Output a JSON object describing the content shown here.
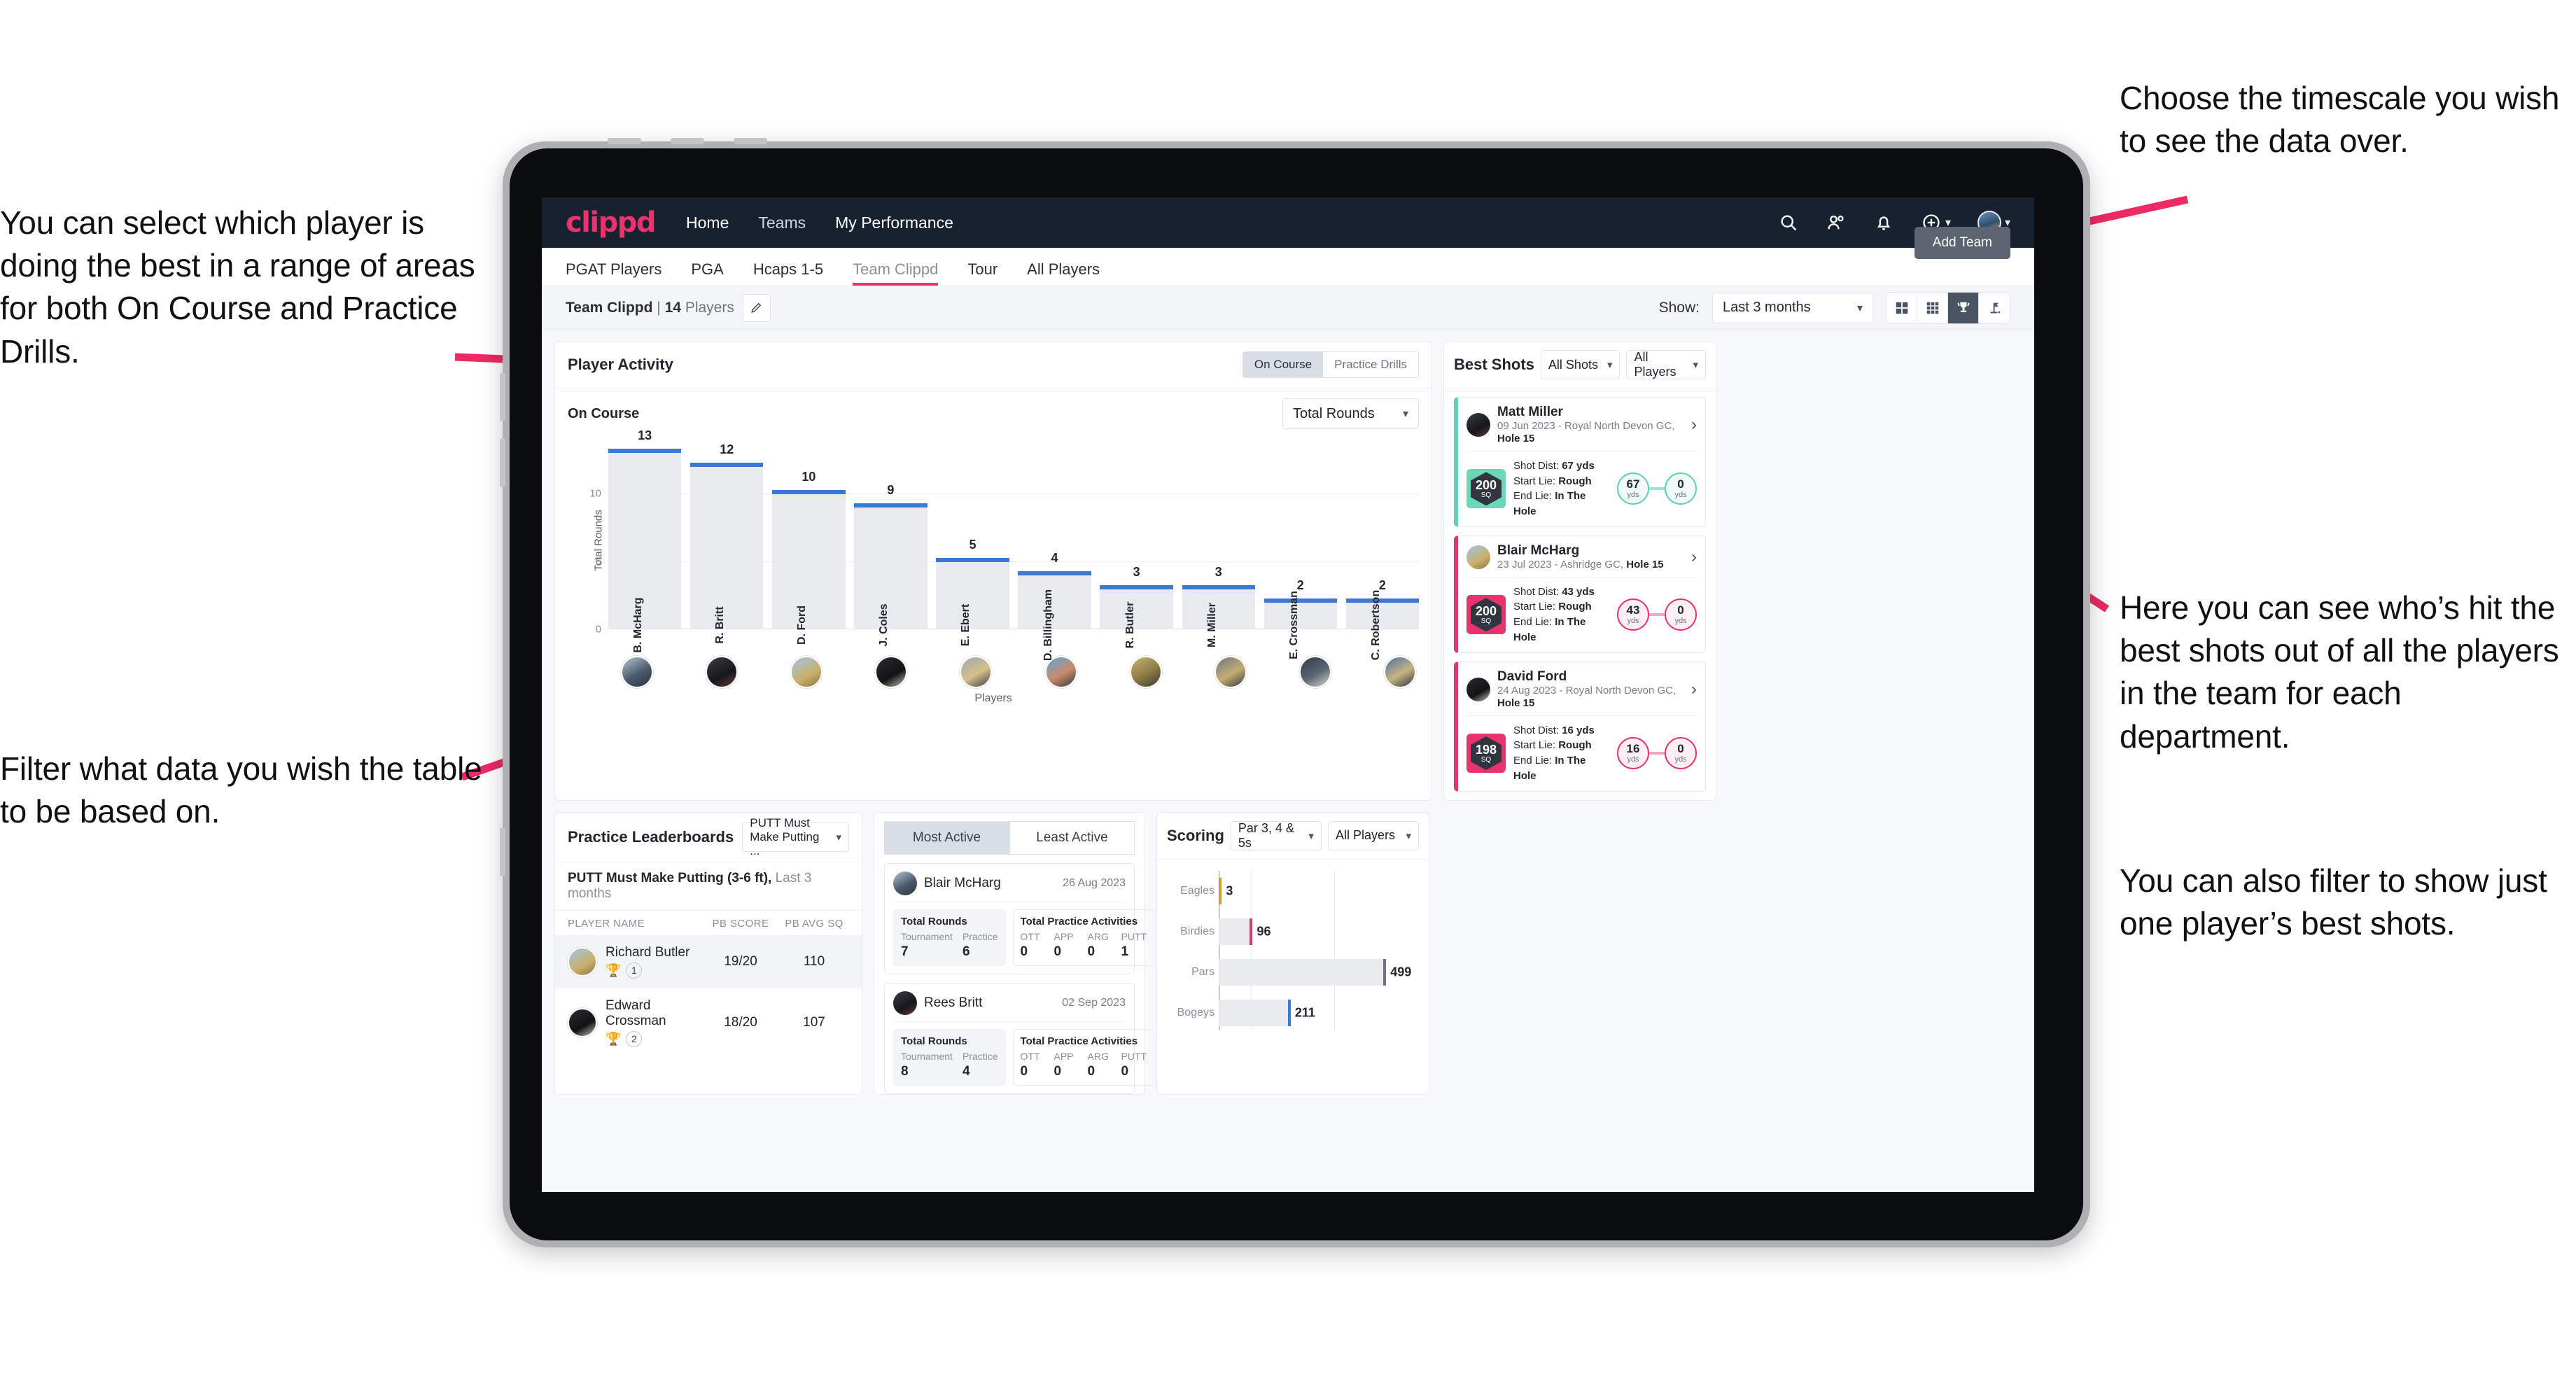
{
  "annotations": {
    "left_top": "You can select which player is doing the best in a range of areas for both On Course and Practice Drills.",
    "left_bottom": "Filter what data you wish the table to be based on.",
    "right_top": "Choose the timescale you wish to see the data over.",
    "right_mid": "Here you can see who’s hit the best shots out of all the players in the team for each department.",
    "right_bottom": "You can also filter to show just one player’s best shots."
  },
  "topnav": {
    "brand": "clippd",
    "links": [
      {
        "label": "Home",
        "active": true
      },
      {
        "label": "Teams",
        "active": false
      },
      {
        "label": "My Performance",
        "active": true
      }
    ],
    "icons": [
      "search-icon",
      "people-icon",
      "bell-icon",
      "plus-circle-icon",
      "avatar"
    ]
  },
  "subtabs": [
    {
      "label": "PGAT Players",
      "active": false
    },
    {
      "label": "PGA",
      "active": false
    },
    {
      "label": "Hcaps 1-5",
      "active": false
    },
    {
      "label": "Team Clippd",
      "active": true
    },
    {
      "label": "Tour",
      "active": false
    },
    {
      "label": "All Players",
      "active": false
    }
  ],
  "add_team_button": "Add Team",
  "toolbar": {
    "team_name": "Team Clippd",
    "separator": "|",
    "player_count": "14",
    "players_word": "Players",
    "show_label": "Show:",
    "timescale_value": "Last 3 months",
    "view_buttons": [
      "grid-2x2-icon",
      "grid-3x3-icon",
      "trophy-icon",
      "flagstick-icon"
    ],
    "active_view": 2
  },
  "player_activity": {
    "title": "Player Activity",
    "segments": [
      {
        "label": "On Course",
        "active": true
      },
      {
        "label": "Practice Drills",
        "active": false
      }
    ],
    "sub_label": "On Course",
    "metric_select": "Total Rounds",
    "x_axis_label": "Players",
    "chart_data": {
      "type": "bar",
      "title": "On Course",
      "xlabel": "Players",
      "ylabel": "Total Rounds",
      "ylim": [
        0,
        14
      ],
      "yticks": [
        0,
        5,
        10
      ],
      "grid": true,
      "categories": [
        "B. McHarg",
        "R. Britt",
        "D. Ford",
        "J. Coles",
        "E. Ebert",
        "D. Billingham",
        "R. Butler",
        "M. Miller",
        "E. Crossman",
        "C. Robertson"
      ],
      "values": [
        13,
        12,
        10,
        9,
        5,
        4,
        3,
        3,
        2,
        2
      ],
      "bar_fill": "#e8eaee",
      "cap_color": "#3b78d8"
    }
  },
  "best_shots": {
    "title": "Best Shots",
    "shot_filter": "All Shots",
    "player_filter": "All Players",
    "shots": [
      {
        "player": "Matt Miller",
        "meta_prefix": "09 Jun 2023 - Royal North Devon GC, ",
        "meta_hole": "Hole 15",
        "sq": "200",
        "sq_unit": "SQ",
        "accent": "teal",
        "shot_dist_label": "Shot Dist: ",
        "shot_dist_value": "67 yds",
        "start_lie_label": "Start Lie: ",
        "start_lie_value": "Rough",
        "end_lie_label": "End Lie: ",
        "end_lie_value": "In The Hole",
        "from_value": "67",
        "from_unit": "yds",
        "to_value": "0",
        "to_unit": "yds"
      },
      {
        "player": "Blair McHarg",
        "meta_prefix": "23 Jul 2023 - Ashridge GC, ",
        "meta_hole": "Hole 15",
        "sq": "200",
        "sq_unit": "SQ",
        "accent": "pink",
        "shot_dist_label": "Shot Dist: ",
        "shot_dist_value": "43 yds",
        "start_lie_label": "Start Lie: ",
        "start_lie_value": "Rough",
        "end_lie_label": "End Lie: ",
        "end_lie_value": "In The Hole",
        "from_value": "43",
        "from_unit": "yds",
        "to_value": "0",
        "to_unit": "yds"
      },
      {
        "player": "David Ford",
        "meta_prefix": "24 Aug 2023 - Royal North Devon GC, ",
        "meta_hole": "Hole 15",
        "sq": "198",
        "sq_unit": "SQ",
        "accent": "pink",
        "shot_dist_label": "Shot Dist: ",
        "shot_dist_value": "16 yds",
        "start_lie_label": "Start Lie: ",
        "start_lie_value": "Rough",
        "end_lie_label": "End Lie: ",
        "end_lie_value": "In The Hole",
        "from_value": "16",
        "from_unit": "yds",
        "to_value": "0",
        "to_unit": "yds"
      }
    ]
  },
  "practice_leaderboards": {
    "title": "Practice Leaderboards",
    "drill_select": "PUTT Must Make Putting ...",
    "caption_bold": "PUTT Must Make Putting (3-6 ft),",
    "caption_muted": " Last 3 months",
    "columns": [
      "PLAYER NAME",
      "PB SCORE",
      "PB AVG SQ"
    ],
    "rows": [
      {
        "name": "Richard Butler",
        "rank": "1",
        "trophy": "gold",
        "pb_score": "19/20",
        "pb_avg_sq": "110"
      },
      {
        "name": "Edward Crossman",
        "rank": "2",
        "trophy": "silver",
        "pb_score": "18/20",
        "pb_avg_sq": "107"
      }
    ]
  },
  "activity": {
    "tabs": [
      {
        "label": "Most Active",
        "active": true
      },
      {
        "label": "Least Active",
        "active": false
      }
    ],
    "rounds_title": "Total Rounds",
    "practice_title": "Total Practice Activities",
    "rounds_cols": [
      "Tournament",
      "Practice"
    ],
    "practice_cols": [
      "OTT",
      "APP",
      "ARG",
      "PUTT"
    ],
    "cards": [
      {
        "name": "Blair McHarg",
        "date": "26 Aug 2023",
        "rounds": [
          "7",
          "6"
        ],
        "practice": [
          "0",
          "0",
          "0",
          "1"
        ]
      },
      {
        "name": "Rees Britt",
        "date": "02 Sep 2023",
        "rounds": [
          "8",
          "4"
        ],
        "practice": [
          "0",
          "0",
          "0",
          "0"
        ]
      }
    ]
  },
  "scoring": {
    "title": "Scoring",
    "par_filter": "Par 3, 4 & 5s",
    "player_filter": "All Players",
    "chart_data": {
      "type": "bar",
      "orientation": "horizontal",
      "title": "Scoring",
      "categories": [
        "Eagles",
        "Birdies",
        "Pars",
        "Bogeys"
      ],
      "values": [
        3,
        96,
        499,
        211
      ],
      "cap_colors": [
        "#c9a227",
        "#e8336d",
        "#6e7682",
        "#3b78d8"
      ],
      "bar_fill": "#e8eaee",
      "xlim": [
        0,
        600
      ],
      "grid": true
    }
  }
}
